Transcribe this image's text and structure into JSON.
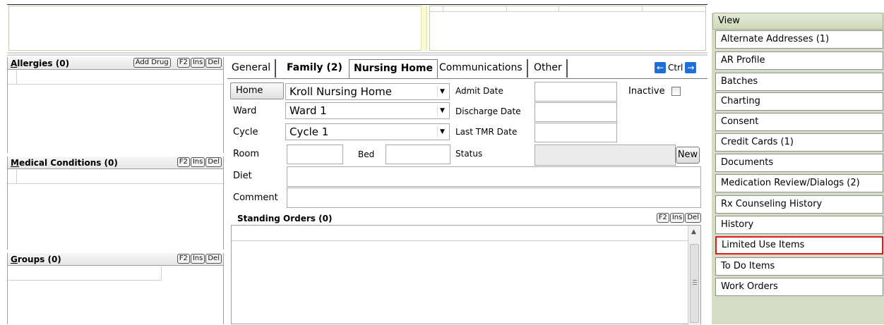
{
  "allergies": {
    "title": "Allergies (0)",
    "add_drug": "Add Drug",
    "keys": [
      "F2",
      "Ins",
      "Del"
    ]
  },
  "medical_conditions": {
    "title": "Medical Conditions (0)",
    "keys": [
      "F2",
      "Ins",
      "Del"
    ]
  },
  "groups": {
    "title": "Groups (0)",
    "keys": [
      "F2",
      "Ins",
      "Del"
    ]
  },
  "tabs": [
    {
      "label": "General"
    },
    {
      "label": "Family (2)"
    },
    {
      "label": "Nursing Home"
    },
    {
      "label": "Communications"
    },
    {
      "label": "Other"
    }
  ],
  "nav": {
    "prev": "←",
    "ctrl": "Ctrl",
    "next": "→"
  },
  "form": {
    "home_label": "Home",
    "home_value": "Kroll Nursing Home",
    "ward_label": "Ward",
    "ward_value": "Ward 1",
    "cycle_label": "Cycle",
    "cycle_value": "Cycle 1",
    "room_label": "Room",
    "bed_label": "Bed",
    "diet_label": "Diet",
    "comment_label": "Comment",
    "admit_label": "Admit Date",
    "discharge_label": "Discharge Date",
    "tmr_label": "Last TMR Date",
    "status_label": "Status",
    "inactive_label": "Inactive",
    "new_button": "New"
  },
  "standing_orders": {
    "title": "Standing Orders (0)",
    "keys": [
      "F2",
      "Ins",
      "Del"
    ]
  },
  "view_panel": {
    "title": "View",
    "items": [
      "Alternate Addresses (1)",
      "AR Profile",
      "Batches",
      "Charting",
      "Consent",
      "Credit Cards (1)",
      "Documents",
      "Medication Review/Dialogs (2)",
      "Rx Counseling History",
      "History",
      "Limited Use Items",
      "To Do Items",
      "Work Orders"
    ],
    "highlighted": "Limited Use Items",
    "highlight_color": "#e21b1b"
  }
}
